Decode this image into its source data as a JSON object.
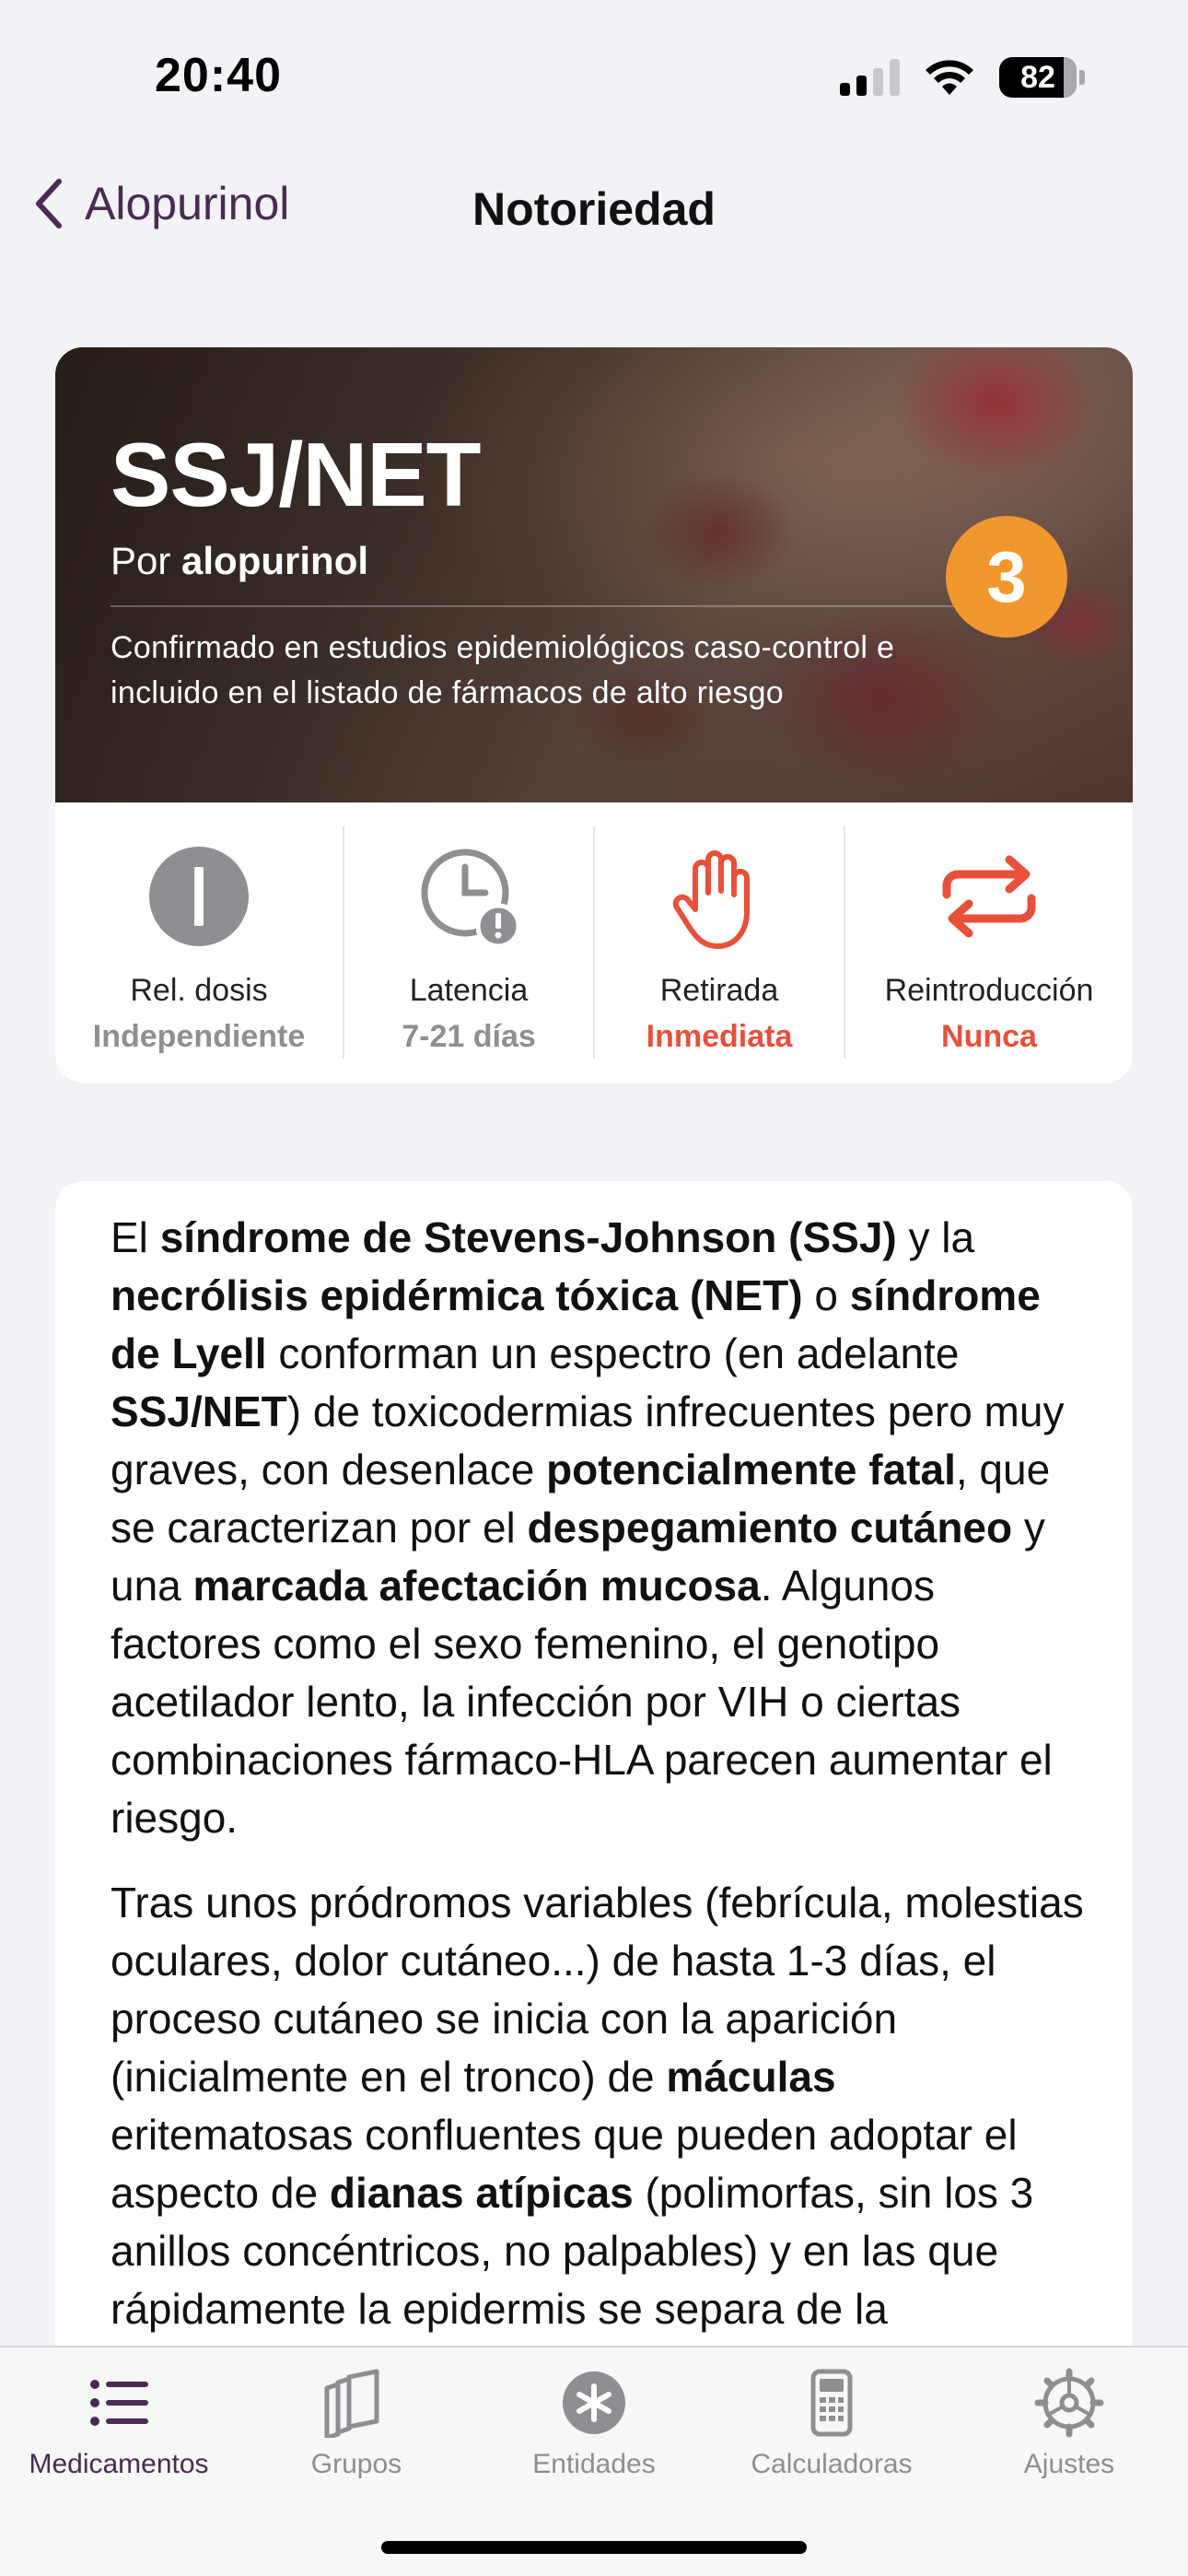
{
  "status_bar": {
    "time": "20:40",
    "battery": "82",
    "icons": [
      "cellular-signal-icon",
      "wifi-icon",
      "battery-icon"
    ]
  },
  "nav": {
    "back_label": "Alopurinol",
    "title": "Notoriedad"
  },
  "hero": {
    "title": "SSJ/NET",
    "subtitle_prefix": "Por",
    "subtitle_drug": "alopurinol",
    "description": "Confirmado en estudios epidemiológicos caso-control e incluido en el listado de fármacos de alto riesgo",
    "badge": "3",
    "badge_color": "#f0982e"
  },
  "stats": [
    {
      "icon": "dose-relation-icon",
      "label": "Rel. dosis",
      "value": "Independiente",
      "value_color": "#8e8e93"
    },
    {
      "icon": "clock-alert-icon",
      "label": "Latencia",
      "value": "7-21 días",
      "value_color": "#8e8e93"
    },
    {
      "icon": "stop-hand-icon",
      "label": "Retirada",
      "value": "Inmediata",
      "value_color": "#e8503a"
    },
    {
      "icon": "reintroduction-arrows-icon",
      "label": "Reintroducción",
      "value": "Nunca",
      "value_color": "#e8503a"
    }
  ],
  "body": {
    "p1": [
      {
        "t": "El ",
        "b": false
      },
      {
        "t": "síndrome de Stevens-Johnson (SSJ)",
        "b": true
      },
      {
        "t": " y la ",
        "b": false
      },
      {
        "t": "necrólisis epidérmica tóxica (NET)",
        "b": true
      },
      {
        "t": " o ",
        "b": false
      },
      {
        "t": "síndrome de Lyell",
        "b": true
      },
      {
        "t": " conforman un espectro (en adelante ",
        "b": false
      },
      {
        "t": "SSJ/NET",
        "b": true
      },
      {
        "t": ") de toxicodermias infrecuentes pero muy graves, con desenlace ",
        "b": false
      },
      {
        "t": "potencialmente fatal",
        "b": true
      },
      {
        "t": ", que se caracterizan por el ",
        "b": false
      },
      {
        "t": "despegamiento cutáneo",
        "b": true
      },
      {
        "t": " y una ",
        "b": false
      },
      {
        "t": "marcada afectación mucosa",
        "b": true
      },
      {
        "t": ". Algunos factores como el sexo femenino, el genotipo acetilador lento, la infección por VIH o ciertas combinaciones fármaco-HLA parecen aumentar el riesgo.",
        "b": false
      }
    ],
    "p2": [
      {
        "t": "Tras unos pródromos variables (febrícula, molestias oculares, dolor cutáneo...) de hasta 1-3 días, el proceso cutáneo se inicia con la aparición (inicialmente en el tronco) de ",
        "b": false
      },
      {
        "t": "máculas",
        "b": true
      },
      {
        "t": " eritematosas confluentes que pueden adoptar el aspecto de ",
        "b": false
      },
      {
        "t": "dianas atípicas",
        "b": true
      },
      {
        "t": " (polimorfas, sin los 3 anillos concéntricos, no palpables) y en las que rápidamente la epidermis se separa de la",
        "b": false
      }
    ]
  },
  "tabs": [
    {
      "icon": "list-icon",
      "label": "Medicamentos",
      "active": true
    },
    {
      "icon": "groups-icon",
      "label": "Grupos",
      "active": false
    },
    {
      "icon": "asterisk-icon",
      "label": "Entidades",
      "active": false
    },
    {
      "icon": "calculator-icon",
      "label": "Calculadoras",
      "active": false
    },
    {
      "icon": "gear-icon",
      "label": "Ajustes",
      "active": false
    }
  ],
  "colors": {
    "accent": "#4a2a55",
    "warning": "#e8503a",
    "badge": "#f0982e"
  }
}
